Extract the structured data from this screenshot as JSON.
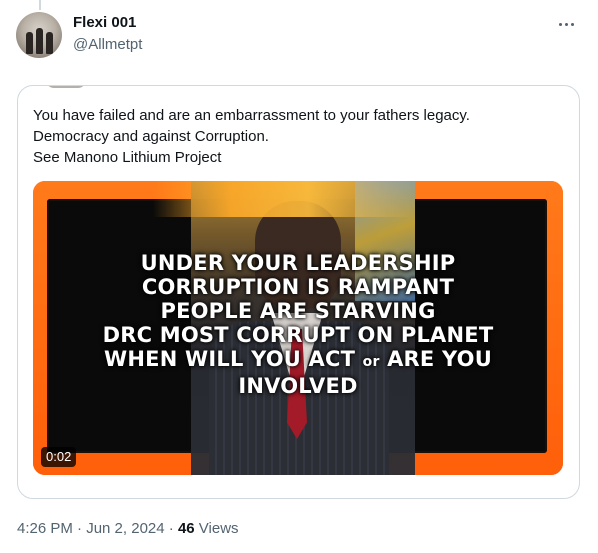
{
  "author": {
    "display_name": "Flexi 001",
    "handle": "@Allmetpt"
  },
  "quoted_tweet": {
    "text_lines": [
      "You have failed and are an embarrassment to your fathers legacy.",
      "Democracy and against Corruption.",
      "See Manono Lithium Project"
    ],
    "video": {
      "overlay_lines": [
        "UNDER YOUR LEADERSHIP",
        "CORRUPTION IS RAMPANT",
        "PEOPLE ARE STARVING",
        "DRC MOST CORRUPT ON PLANET",
        "WHEN WILL YOU ACT",
        "or",
        "ARE YOU",
        "INVOLVED"
      ],
      "duration": "0:02"
    }
  },
  "meta": {
    "timestamp": "4:26 PM · Jun 2, 2024",
    "separator": " · ",
    "views_count": "46",
    "views_label": " Views"
  },
  "icons": {
    "more": "more-horizontal-icon"
  }
}
